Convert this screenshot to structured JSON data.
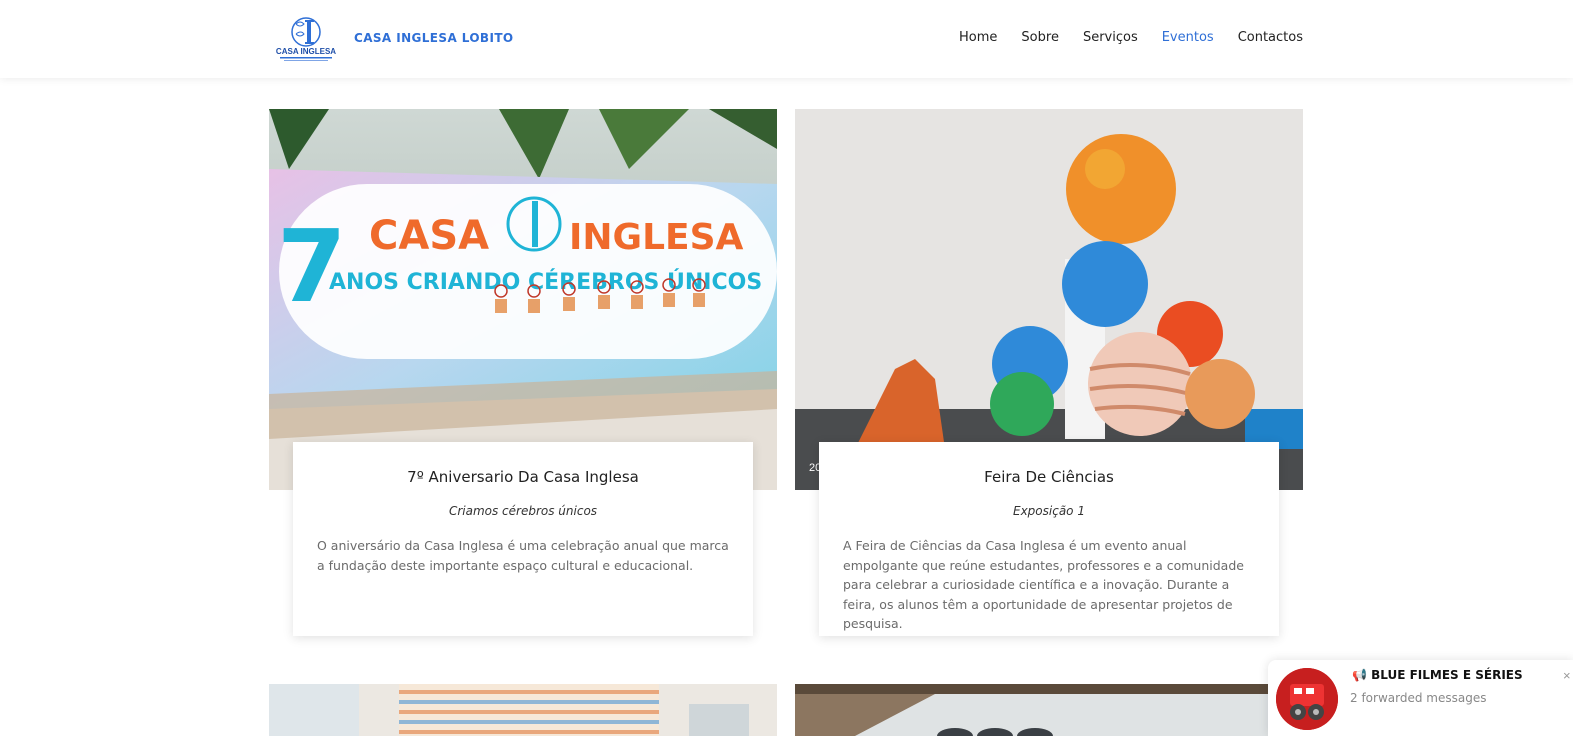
{
  "header": {
    "brand": "CASA INGLESA LOBITO",
    "logo_text": "CASA INGLESA",
    "nav": [
      {
        "label": "Home"
      },
      {
        "label": "Sobre"
      },
      {
        "label": "Serviços"
      },
      {
        "label": "Eventos",
        "active": true
      },
      {
        "label": "Contactos"
      }
    ]
  },
  "cards": [
    {
      "image_banner_line1": "CASA",
      "image_banner_line1b": "INGLESA",
      "image_banner_line2": "ANOS CRIANDO CÉREBROS ÚNICOS",
      "image_banner_number": "7",
      "title": "7º Aniversario Da Casa Inglesa",
      "subtitle": "Criamos cérebros únicos",
      "text": "O aniversário da Casa Inglesa é uma celebração anual que marca a fundação deste importante espaço cultural e educacional."
    },
    {
      "date_fragment": "20",
      "title": "Feira De Ciências",
      "subtitle": "Exposição 1",
      "text": "A Feira de Ciências da Casa Inglesa é um evento anual empolgante que reúne estudantes, professores e a comunidade para celebrar a curiosidade científica e a inovação. Durante a feira, os alunos têm a oportunidade de apresentar projetos de pesquisa."
    }
  ],
  "notification": {
    "title": "📢 BLUE FILMES E SÉRIES",
    "subtitle": "2 forwarded messages",
    "close": "×"
  },
  "colors": {
    "accent": "#2f6fd6",
    "nav_text": "#222222",
    "body_text": "#6b6b6b"
  }
}
